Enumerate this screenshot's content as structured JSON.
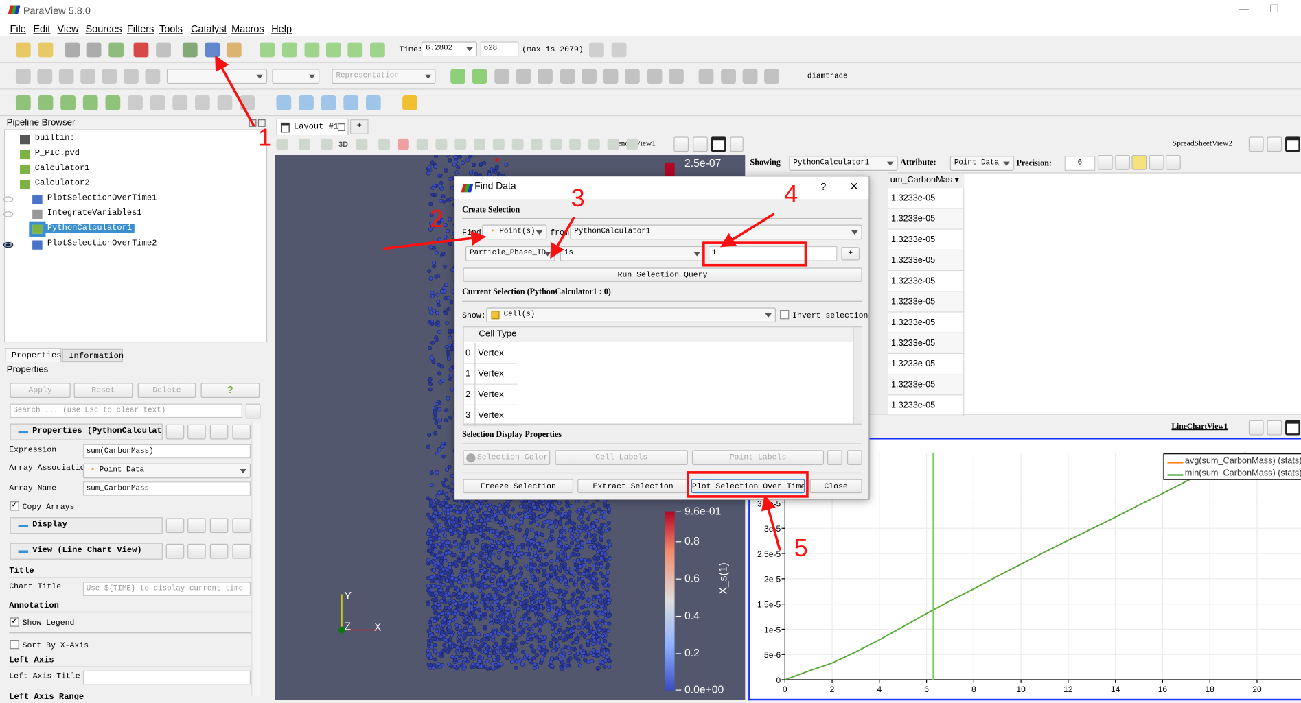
{
  "window": {
    "title": "ParaView 5.8.0",
    "minimize": "—",
    "maximize": "☐"
  },
  "menu": [
    "File",
    "Edit",
    "View",
    "Sources",
    "Filters",
    "Tools",
    "Catalyst",
    "Macros",
    "Help"
  ],
  "toolbar1": {
    "icons": [
      {
        "name": "open-file-icon",
        "color": "#e8c24c"
      },
      {
        "name": "save-data-icon",
        "color": "#e8c24c"
      },
      {
        "name": "connect-icon",
        "color": "#a0a0a0"
      },
      {
        "name": "disconnect-icon",
        "color": "#a0a0a0"
      },
      {
        "name": "auto-apply-icon",
        "color": "#7cb36a"
      },
      {
        "name": "undo-icon",
        "color": "#d22a2a"
      },
      {
        "name": "redo-icon",
        "color": "#b8b8b8"
      },
      {
        "name": "python-shell-icon",
        "color": "#6f9c62"
      },
      {
        "name": "find-data-icon",
        "color": "#4a74c9"
      },
      {
        "name": "color-palette-icon",
        "color": "#d9a85a"
      },
      {
        "name": "first-frame-icon",
        "color": "#8fcf7a"
      },
      {
        "name": "previous-frame-icon",
        "color": "#8fcf7a"
      },
      {
        "name": "play-icon",
        "color": "#8fcf7a"
      },
      {
        "name": "next-frame-icon",
        "color": "#8fcf7a"
      },
      {
        "name": "last-frame-icon",
        "color": "#8fcf7a"
      },
      {
        "name": "loop-icon",
        "color": "#8fcf7a"
      }
    ],
    "time_label": "Time:",
    "time_value": "6.2802",
    "timestep": "628",
    "max_label": "(max is 2079)"
  },
  "toolbar2": {
    "representation_placeholder": "Representation",
    "macro": "diamtrace"
  },
  "pipeline": {
    "title": "Pipeline Browser",
    "items": [
      "builtin:",
      "P_PIC.pvd",
      "Calculator1",
      "Calculator2",
      "PlotSelectionOverTime1",
      "IntegrateVariables1",
      "PythonCalculator1",
      "PlotSelectionOverTime2"
    ],
    "selected": "PythonCalculator1"
  },
  "properties": {
    "tabs": [
      "Properties",
      "Information"
    ],
    "title": "Properties",
    "apply": "Apply",
    "reset": "Reset",
    "delete": "Delete",
    "help": "?",
    "search_placeholder": "Search ... (use Esc to clear text)",
    "section_properties": "Properties (PythonCalculat",
    "expression_label": "Expression",
    "expression_value": "sum(CarbonMass)",
    "array_assoc_label": "Array Association",
    "array_assoc_value": "Point Data",
    "array_name_label": "Array Name",
    "array_name_value": "sum_CarbonMass",
    "copy_arrays": "Copy Arrays",
    "section_display": "Display",
    "section_view": "View (Line Chart View)",
    "title_group": "Title",
    "chart_title_label": "Chart Title",
    "chart_title_placeholder": "Use ${TIME} to display current time",
    "annotation_group": "Annotation",
    "show_legend": "Show Legend",
    "sort_by_x": "Sort By X-Axis",
    "left_axis_group": "Left Axis",
    "left_axis_title_label": "Left Axis Title",
    "left_axis_range_label": "Left Axis Range"
  },
  "layout": {
    "tab": "Layout #1",
    "add_tab": "+",
    "render_view": "RenderView1",
    "three_d": "3D"
  },
  "render": {
    "scalar_bar_top": {
      "label": "2.5e-07"
    },
    "scalar_bar": {
      "title": "X_s(1)",
      "ticks": [
        "9.6e-01",
        "0.8",
        "0.6",
        "0.4",
        "0.2",
        "0.0e+00"
      ]
    },
    "axes": {
      "x": "X",
      "y": "Y",
      "z": "Z"
    }
  },
  "spreadsheet": {
    "view_name": "SpreadSheetView2",
    "showing_label": "Showing",
    "showing_value": "PythonCalculator1",
    "attribute_label": "Attribute:",
    "attribute_value": "Point Data",
    "precision_label": "Precision:",
    "precision_value": "6",
    "column": "um_CarbonMas",
    "rows": [
      "1.3233e-05",
      "1.3233e-05",
      "1.3233e-05",
      "1.3233e-05",
      "1.3233e-05",
      "1.3233e-05",
      "1.3233e-05",
      "1.3233e-05",
      "1.3233e-05",
      "1.3233e-05",
      "1.3233e-05"
    ]
  },
  "linechart": {
    "view_name": "LineChartView1"
  },
  "chart_data": {
    "type": "line",
    "x": [
      0,
      1,
      2,
      3,
      4,
      5,
      6,
      7,
      8,
      9,
      10,
      11,
      12,
      13,
      14,
      15,
      16,
      17,
      18,
      19,
      20
    ],
    "series": [
      {
        "name": "avg(sum_CarbonMass) (stats)",
        "color": "#ff7f0e",
        "values": [
          0,
          1.7e-06,
          3.3e-06,
          5.5e-06,
          7.9e-06,
          1.05e-05,
          1.31e-05,
          1.56e-05,
          1.8e-05,
          2.05e-05,
          2.29e-05,
          2.53e-05,
          2.76e-05,
          2.99e-05,
          3.22e-05,
          3.46e-05,
          3.69e-05,
          3.93e-05,
          4.16e-05,
          4.39e-05,
          4.62e-05
        ]
      },
      {
        "name": "min(sum_CarbonMass) (stats)",
        "color": "#4daf3c",
        "values": [
          0,
          1.7e-06,
          3.3e-06,
          5.5e-06,
          7.9e-06,
          1.05e-05,
          1.31e-05,
          1.56e-05,
          1.8e-05,
          2.05e-05,
          2.29e-05,
          2.53e-05,
          2.76e-05,
          2.99e-05,
          3.22e-05,
          3.46e-05,
          3.69e-05,
          3.93e-05,
          4.16e-05,
          4.39e-05,
          4.62e-05
        ]
      }
    ],
    "current_time": 6.2802,
    "xlim": [
      0,
      22
    ],
    "ylim": [
      0,
      4.5e-05
    ],
    "xticks": [
      "0",
      "2",
      "4",
      "6",
      "8",
      "10",
      "12",
      "14",
      "16",
      "18",
      "20"
    ],
    "yticks": [
      "0",
      "5e-6",
      "1e-5",
      "1.5e-5",
      "2e-5",
      "2.5e-5",
      "3e-5",
      "3.5e-5"
    ],
    "grid": true,
    "legend": "top-right"
  },
  "find_data": {
    "title": "Find Data",
    "help": "?",
    "close_x": "✕",
    "create_selection": "Create Selection",
    "find_label": "Find",
    "find_type": "Point(s)",
    "from_label": "from",
    "from_value": "PythonCalculator1",
    "query_field": "Particle_Phase_ID",
    "query_op": "is",
    "query_value": "1",
    "add": "+",
    "run_query": "Run Selection Query",
    "current_selection": "Current Selection (PythonCalculator1 : 0)",
    "show_label": "Show:",
    "show_value": "Cell(s)",
    "invert": "Invert selection",
    "table_header": "Cell Type",
    "rows": [
      {
        "i": "0",
        "type": "Vertex"
      },
      {
        "i": "1",
        "type": "Vertex"
      },
      {
        "i": "2",
        "type": "Vertex"
      },
      {
        "i": "3",
        "type": "Vertex"
      }
    ],
    "display_props": "Selection Display Properties",
    "selection_color": "Selection Color",
    "cell_labels": "Cell Labels",
    "point_labels": "Point Labels",
    "freeze": "Freeze Selection",
    "extract": "Extract Selection",
    "plot_over_time": "Plot Selection Over Time",
    "close": "Close"
  },
  "annotations": {
    "color": "#ff1010",
    "steps": [
      "1",
      "2",
      "3",
      "4",
      "5"
    ]
  }
}
